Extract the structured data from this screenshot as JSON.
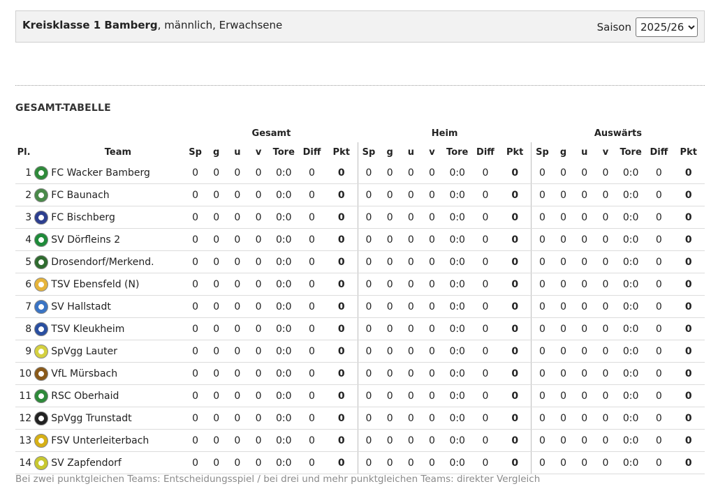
{
  "league": {
    "name_bold": "Kreisklasse 1 Bamberg",
    "name_rest": ", männlich, Erwachsene",
    "saison_label": "Saison",
    "saison_value": "2025/26"
  },
  "section_title": "GESAMT-TABELLE",
  "groups": {
    "gesamt": "Gesamt",
    "heim": "Heim",
    "auswaerts": "Auswärts"
  },
  "columns": {
    "pl": "Pl.",
    "team": "Team",
    "sp": "Sp",
    "g": "g",
    "u": "u",
    "v": "v",
    "tore": "Tore",
    "diff": "Diff",
    "pkt": "Pkt"
  },
  "logo_colors": [
    "#2f8a3a",
    "#4a8a4a",
    "#2d3f8f",
    "#1f8b3a",
    "#2f6b2f",
    "#e6b43a",
    "#3a74c4",
    "#2a4fa0",
    "#d4d040",
    "#8a5a1a",
    "#2e8a3a",
    "#222222",
    "#d6b016",
    "#c8c830"
  ],
  "teams": [
    {
      "pl": "1",
      "team": "FC Wacker Bamberg",
      "logo": "club-crest-icon",
      "gesamt": [
        "0",
        "0",
        "0",
        "0",
        "0:0",
        "0",
        "0"
      ],
      "heim": [
        "0",
        "0",
        "0",
        "0",
        "0:0",
        "0",
        "0"
      ],
      "auswaerts": [
        "0",
        "0",
        "0",
        "0",
        "0:0",
        "0",
        "0"
      ]
    },
    {
      "pl": "2",
      "team": "FC Baunach",
      "logo": "club-crest-icon",
      "gesamt": [
        "0",
        "0",
        "0",
        "0",
        "0:0",
        "0",
        "0"
      ],
      "heim": [
        "0",
        "0",
        "0",
        "0",
        "0:0",
        "0",
        "0"
      ],
      "auswaerts": [
        "0",
        "0",
        "0",
        "0",
        "0:0",
        "0",
        "0"
      ]
    },
    {
      "pl": "3",
      "team": "FC Bischberg",
      "logo": "club-crest-icon",
      "gesamt": [
        "0",
        "0",
        "0",
        "0",
        "0:0",
        "0",
        "0"
      ],
      "heim": [
        "0",
        "0",
        "0",
        "0",
        "0:0",
        "0",
        "0"
      ],
      "auswaerts": [
        "0",
        "0",
        "0",
        "0",
        "0:0",
        "0",
        "0"
      ]
    },
    {
      "pl": "4",
      "team": "SV Dörfleins 2",
      "logo": "club-crest-icon",
      "gesamt": [
        "0",
        "0",
        "0",
        "0",
        "0:0",
        "0",
        "0"
      ],
      "heim": [
        "0",
        "0",
        "0",
        "0",
        "0:0",
        "0",
        "0"
      ],
      "auswaerts": [
        "0",
        "0",
        "0",
        "0",
        "0:0",
        "0",
        "0"
      ]
    },
    {
      "pl": "5",
      "team": "Drosendorf/Merkend.",
      "logo": "club-crest-icon",
      "gesamt": [
        "0",
        "0",
        "0",
        "0",
        "0:0",
        "0",
        "0"
      ],
      "heim": [
        "0",
        "0",
        "0",
        "0",
        "0:0",
        "0",
        "0"
      ],
      "auswaerts": [
        "0",
        "0",
        "0",
        "0",
        "0:0",
        "0",
        "0"
      ]
    },
    {
      "pl": "6",
      "team": "TSV Ebensfeld (N)",
      "logo": "club-crest-icon",
      "gesamt": [
        "0",
        "0",
        "0",
        "0",
        "0:0",
        "0",
        "0"
      ],
      "heim": [
        "0",
        "0",
        "0",
        "0",
        "0:0",
        "0",
        "0"
      ],
      "auswaerts": [
        "0",
        "0",
        "0",
        "0",
        "0:0",
        "0",
        "0"
      ]
    },
    {
      "pl": "7",
      "team": "SV Hallstadt",
      "logo": "club-crest-icon",
      "gesamt": [
        "0",
        "0",
        "0",
        "0",
        "0:0",
        "0",
        "0"
      ],
      "heim": [
        "0",
        "0",
        "0",
        "0",
        "0:0",
        "0",
        "0"
      ],
      "auswaerts": [
        "0",
        "0",
        "0",
        "0",
        "0:0",
        "0",
        "0"
      ]
    },
    {
      "pl": "8",
      "team": "TSV Kleukheim",
      "logo": "club-crest-icon",
      "gesamt": [
        "0",
        "0",
        "0",
        "0",
        "0:0",
        "0",
        "0"
      ],
      "heim": [
        "0",
        "0",
        "0",
        "0",
        "0:0",
        "0",
        "0"
      ],
      "auswaerts": [
        "0",
        "0",
        "0",
        "0",
        "0:0",
        "0",
        "0"
      ]
    },
    {
      "pl": "9",
      "team": "SpVgg Lauter",
      "logo": "club-crest-icon",
      "gesamt": [
        "0",
        "0",
        "0",
        "0",
        "0:0",
        "0",
        "0"
      ],
      "heim": [
        "0",
        "0",
        "0",
        "0",
        "0:0",
        "0",
        "0"
      ],
      "auswaerts": [
        "0",
        "0",
        "0",
        "0",
        "0:0",
        "0",
        "0"
      ]
    },
    {
      "pl": "10",
      "team": "VfL Mürsbach",
      "logo": "club-crest-icon",
      "gesamt": [
        "0",
        "0",
        "0",
        "0",
        "0:0",
        "0",
        "0"
      ],
      "heim": [
        "0",
        "0",
        "0",
        "0",
        "0:0",
        "0",
        "0"
      ],
      "auswaerts": [
        "0",
        "0",
        "0",
        "0",
        "0:0",
        "0",
        "0"
      ]
    },
    {
      "pl": "11",
      "team": "RSC Oberhaid",
      "logo": "club-crest-icon",
      "gesamt": [
        "0",
        "0",
        "0",
        "0",
        "0:0",
        "0",
        "0"
      ],
      "heim": [
        "0",
        "0",
        "0",
        "0",
        "0:0",
        "0",
        "0"
      ],
      "auswaerts": [
        "0",
        "0",
        "0",
        "0",
        "0:0",
        "0",
        "0"
      ]
    },
    {
      "pl": "12",
      "team": "SpVgg Trunstadt",
      "logo": "club-crest-icon",
      "gesamt": [
        "0",
        "0",
        "0",
        "0",
        "0:0",
        "0",
        "0"
      ],
      "heim": [
        "0",
        "0",
        "0",
        "0",
        "0:0",
        "0",
        "0"
      ],
      "auswaerts": [
        "0",
        "0",
        "0",
        "0",
        "0:0",
        "0",
        "0"
      ]
    },
    {
      "pl": "13",
      "team": "FSV Unterleiterbach",
      "logo": "club-crest-icon",
      "gesamt": [
        "0",
        "0",
        "0",
        "0",
        "0:0",
        "0",
        "0"
      ],
      "heim": [
        "0",
        "0",
        "0",
        "0",
        "0:0",
        "0",
        "0"
      ],
      "auswaerts": [
        "0",
        "0",
        "0",
        "0",
        "0:0",
        "0",
        "0"
      ]
    },
    {
      "pl": "14",
      "team": "SV Zapfendorf",
      "logo": "club-crest-icon",
      "gesamt": [
        "0",
        "0",
        "0",
        "0",
        "0:0",
        "0",
        "0"
      ],
      "heim": [
        "0",
        "0",
        "0",
        "0",
        "0:0",
        "0",
        "0"
      ],
      "auswaerts": [
        "0",
        "0",
        "0",
        "0",
        "0:0",
        "0",
        "0"
      ]
    }
  ],
  "footnote": "Bei zwei punktgleichen Teams: Entscheidungsspiel / bei drei und mehr punktgleichen Teams: direkter Vergleich"
}
